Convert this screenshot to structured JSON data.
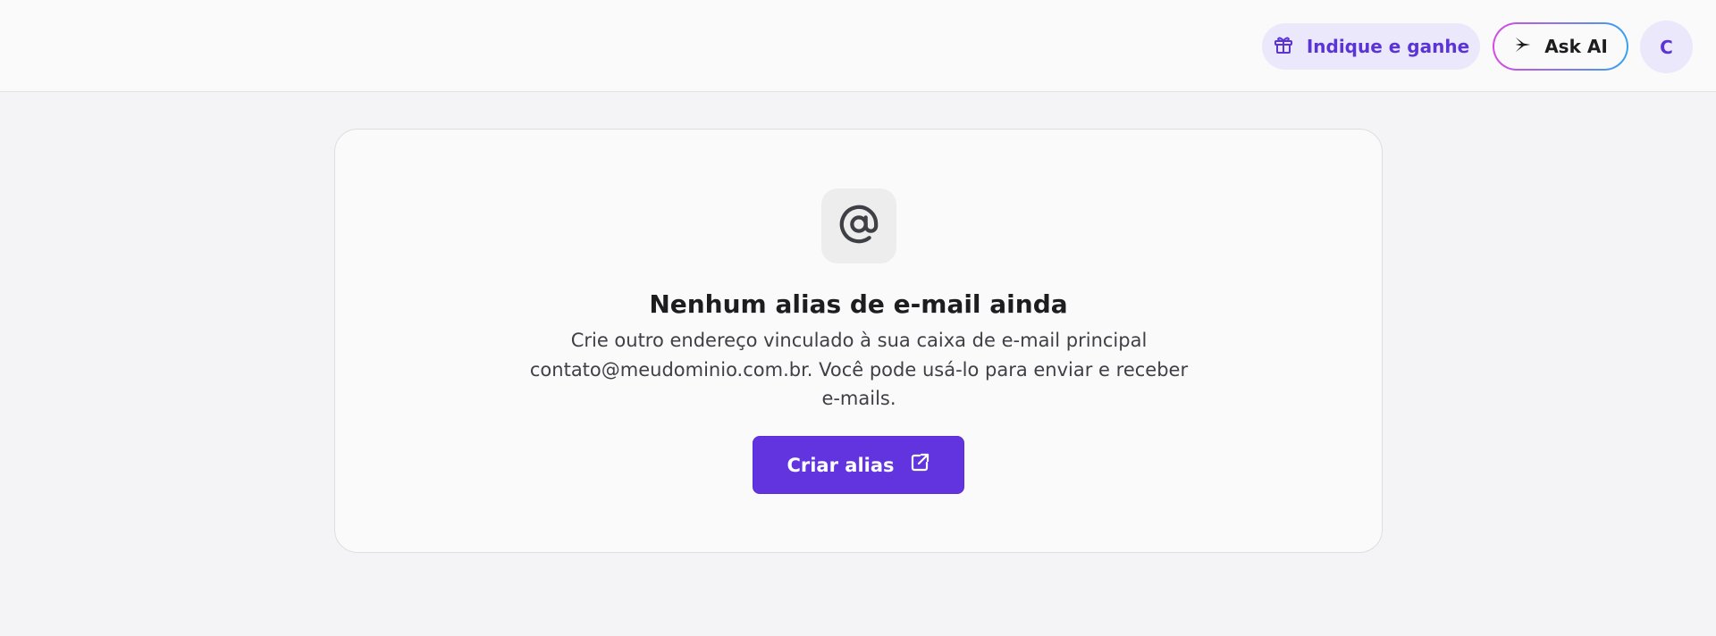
{
  "header": {
    "refer_label": "Indique e ganhe",
    "ask_ai_label": "Ask AI",
    "avatar_initial": "C"
  },
  "empty_state": {
    "title": "Nenhum alias de e-mail ainda",
    "description": "Crie outro endereço vinculado à sua caixa de e-mail principal contato@meudominio.com.br. Você pode usá-lo para enviar e receber e-mails.",
    "button_label": "Criar alias"
  },
  "colors": {
    "accent": "#6234e0",
    "accent_soft": "#ebe8fb",
    "accent_text": "#5b34d6"
  },
  "icons": {
    "refer": "gift-icon",
    "ask_ai": "sparkle-icon",
    "empty_state": "at-sign-icon",
    "create": "external-link-icon"
  }
}
